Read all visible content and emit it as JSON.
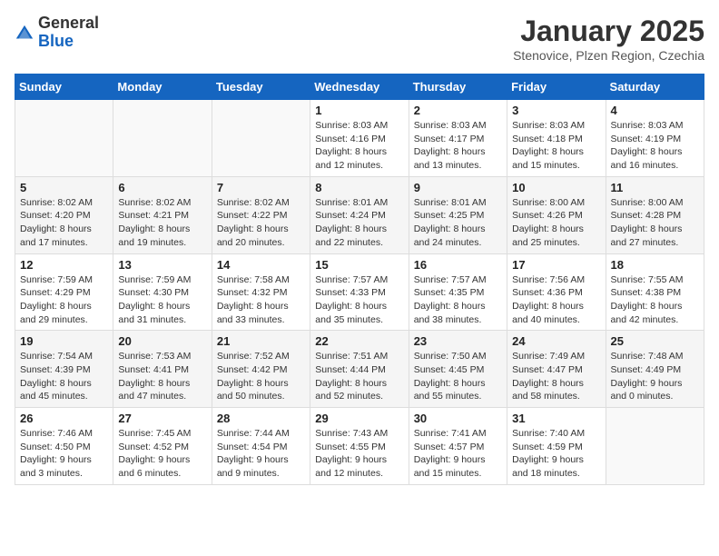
{
  "header": {
    "logo_general": "General",
    "logo_blue": "Blue",
    "month_title": "January 2025",
    "subtitle": "Stenovice, Plzen Region, Czechia"
  },
  "days_of_week": [
    "Sunday",
    "Monday",
    "Tuesday",
    "Wednesday",
    "Thursday",
    "Friday",
    "Saturday"
  ],
  "weeks": [
    [
      {
        "day": "",
        "info": ""
      },
      {
        "day": "",
        "info": ""
      },
      {
        "day": "",
        "info": ""
      },
      {
        "day": "1",
        "info": "Sunrise: 8:03 AM\nSunset: 4:16 PM\nDaylight: 8 hours and 12 minutes."
      },
      {
        "day": "2",
        "info": "Sunrise: 8:03 AM\nSunset: 4:17 PM\nDaylight: 8 hours and 13 minutes."
      },
      {
        "day": "3",
        "info": "Sunrise: 8:03 AM\nSunset: 4:18 PM\nDaylight: 8 hours and 15 minutes."
      },
      {
        "day": "4",
        "info": "Sunrise: 8:03 AM\nSunset: 4:19 PM\nDaylight: 8 hours and 16 minutes."
      }
    ],
    [
      {
        "day": "5",
        "info": "Sunrise: 8:02 AM\nSunset: 4:20 PM\nDaylight: 8 hours and 17 minutes."
      },
      {
        "day": "6",
        "info": "Sunrise: 8:02 AM\nSunset: 4:21 PM\nDaylight: 8 hours and 19 minutes."
      },
      {
        "day": "7",
        "info": "Sunrise: 8:02 AM\nSunset: 4:22 PM\nDaylight: 8 hours and 20 minutes."
      },
      {
        "day": "8",
        "info": "Sunrise: 8:01 AM\nSunset: 4:24 PM\nDaylight: 8 hours and 22 minutes."
      },
      {
        "day": "9",
        "info": "Sunrise: 8:01 AM\nSunset: 4:25 PM\nDaylight: 8 hours and 24 minutes."
      },
      {
        "day": "10",
        "info": "Sunrise: 8:00 AM\nSunset: 4:26 PM\nDaylight: 8 hours and 25 minutes."
      },
      {
        "day": "11",
        "info": "Sunrise: 8:00 AM\nSunset: 4:28 PM\nDaylight: 8 hours and 27 minutes."
      }
    ],
    [
      {
        "day": "12",
        "info": "Sunrise: 7:59 AM\nSunset: 4:29 PM\nDaylight: 8 hours and 29 minutes."
      },
      {
        "day": "13",
        "info": "Sunrise: 7:59 AM\nSunset: 4:30 PM\nDaylight: 8 hours and 31 minutes."
      },
      {
        "day": "14",
        "info": "Sunrise: 7:58 AM\nSunset: 4:32 PM\nDaylight: 8 hours and 33 minutes."
      },
      {
        "day": "15",
        "info": "Sunrise: 7:57 AM\nSunset: 4:33 PM\nDaylight: 8 hours and 35 minutes."
      },
      {
        "day": "16",
        "info": "Sunrise: 7:57 AM\nSunset: 4:35 PM\nDaylight: 8 hours and 38 minutes."
      },
      {
        "day": "17",
        "info": "Sunrise: 7:56 AM\nSunset: 4:36 PM\nDaylight: 8 hours and 40 minutes."
      },
      {
        "day": "18",
        "info": "Sunrise: 7:55 AM\nSunset: 4:38 PM\nDaylight: 8 hours and 42 minutes."
      }
    ],
    [
      {
        "day": "19",
        "info": "Sunrise: 7:54 AM\nSunset: 4:39 PM\nDaylight: 8 hours and 45 minutes."
      },
      {
        "day": "20",
        "info": "Sunrise: 7:53 AM\nSunset: 4:41 PM\nDaylight: 8 hours and 47 minutes."
      },
      {
        "day": "21",
        "info": "Sunrise: 7:52 AM\nSunset: 4:42 PM\nDaylight: 8 hours and 50 minutes."
      },
      {
        "day": "22",
        "info": "Sunrise: 7:51 AM\nSunset: 4:44 PM\nDaylight: 8 hours and 52 minutes."
      },
      {
        "day": "23",
        "info": "Sunrise: 7:50 AM\nSunset: 4:45 PM\nDaylight: 8 hours and 55 minutes."
      },
      {
        "day": "24",
        "info": "Sunrise: 7:49 AM\nSunset: 4:47 PM\nDaylight: 8 hours and 58 minutes."
      },
      {
        "day": "25",
        "info": "Sunrise: 7:48 AM\nSunset: 4:49 PM\nDaylight: 9 hours and 0 minutes."
      }
    ],
    [
      {
        "day": "26",
        "info": "Sunrise: 7:46 AM\nSunset: 4:50 PM\nDaylight: 9 hours and 3 minutes."
      },
      {
        "day": "27",
        "info": "Sunrise: 7:45 AM\nSunset: 4:52 PM\nDaylight: 9 hours and 6 minutes."
      },
      {
        "day": "28",
        "info": "Sunrise: 7:44 AM\nSunset: 4:54 PM\nDaylight: 9 hours and 9 minutes."
      },
      {
        "day": "29",
        "info": "Sunrise: 7:43 AM\nSunset: 4:55 PM\nDaylight: 9 hours and 12 minutes."
      },
      {
        "day": "30",
        "info": "Sunrise: 7:41 AM\nSunset: 4:57 PM\nDaylight: 9 hours and 15 minutes."
      },
      {
        "day": "31",
        "info": "Sunrise: 7:40 AM\nSunset: 4:59 PM\nDaylight: 9 hours and 18 minutes."
      },
      {
        "day": "",
        "info": ""
      }
    ]
  ]
}
